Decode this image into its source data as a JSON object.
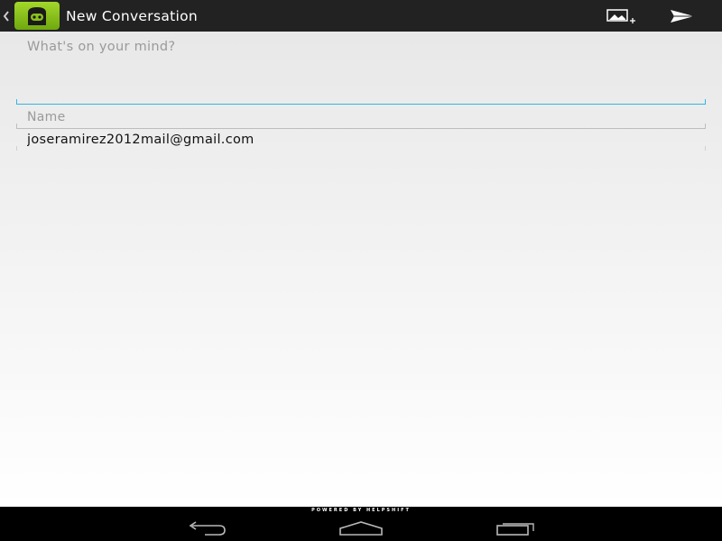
{
  "action_bar": {
    "title": "New Conversation",
    "icons": {
      "up": "chevron-left-icon",
      "app": "helpshift-logo-icon",
      "attach": "add-image-icon",
      "send": "send-icon"
    }
  },
  "form": {
    "message_placeholder": "What's on your mind?",
    "message_value": "",
    "name_placeholder": "Name",
    "name_value": "",
    "email_value": "joseramirez2012mail@gmail.com"
  },
  "footer": {
    "powered_by": "POWERED BY HELPSHIFT"
  },
  "nav": {
    "icons": [
      "back-icon",
      "home-icon",
      "recents-icon"
    ]
  },
  "colors": {
    "action_bar_bg": "#222222",
    "accent": "#33b5e5",
    "app_icon_green": "#8bc21c",
    "nav_bg": "#000000"
  }
}
